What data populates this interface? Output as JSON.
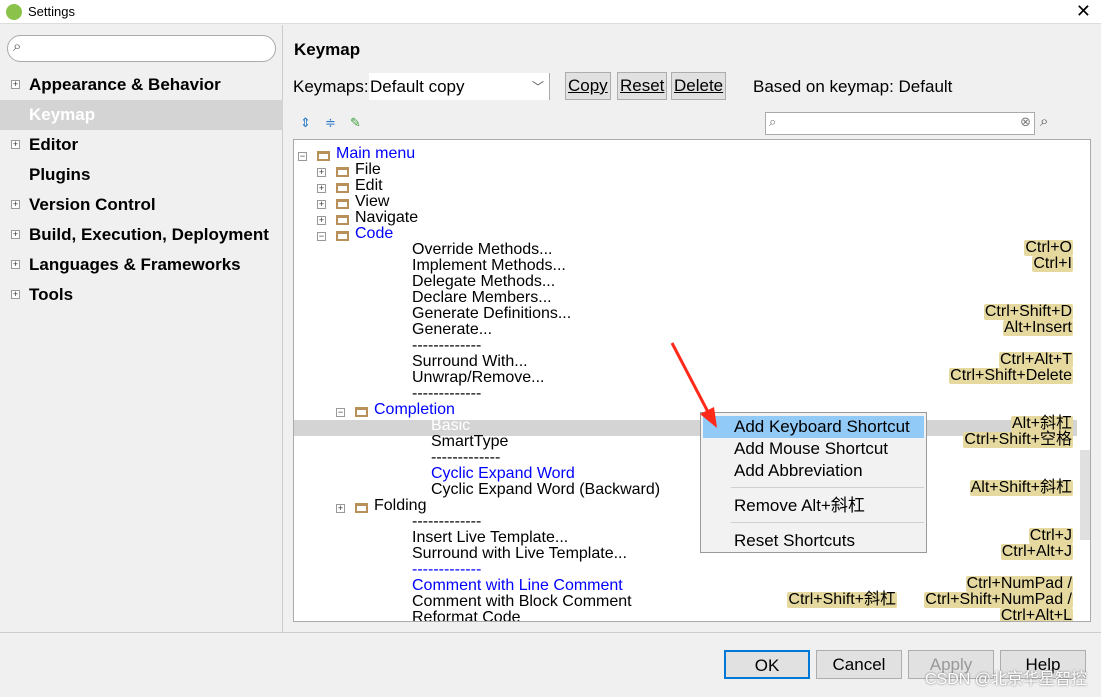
{
  "window": {
    "title": "Settings"
  },
  "sidebar": {
    "search_placeholder": "",
    "items": [
      {
        "label": "Appearance & Behavior",
        "expandable": true
      },
      {
        "label": "Keymap",
        "selected": true
      },
      {
        "label": "Editor",
        "expandable": true
      },
      {
        "label": "Plugins"
      },
      {
        "label": "Version Control",
        "expandable": true
      },
      {
        "label": "Build, Execution, Deployment",
        "expandable": true
      },
      {
        "label": "Languages & Frameworks",
        "expandable": true
      },
      {
        "label": "Tools",
        "expandable": true
      }
    ]
  },
  "main": {
    "title": "Keymap",
    "keymaps_label": "Keymaps:",
    "keymap_value": "Default copy",
    "copy": "Copy",
    "reset": "Reset",
    "delete": "Delete",
    "based_on": "Based on keymap: Default",
    "filter_value": ""
  },
  "tree": [
    {
      "label": "Main menu",
      "level": 0,
      "type": "root",
      "blue": true,
      "expanded": true
    },
    {
      "label": "File",
      "level": 1,
      "type": "folder"
    },
    {
      "label": "Edit",
      "level": 1,
      "type": "folder"
    },
    {
      "label": "View",
      "level": 1,
      "type": "folder"
    },
    {
      "label": "Navigate",
      "level": 1,
      "type": "folder"
    },
    {
      "label": "Code",
      "level": 1,
      "type": "folder",
      "blue": true,
      "expanded": true
    },
    {
      "label": "Override Methods...",
      "level": 2,
      "shortcuts": [
        "Ctrl+O"
      ]
    },
    {
      "label": "Implement Methods...",
      "level": 2,
      "shortcuts": [
        "Ctrl+I"
      ]
    },
    {
      "label": "Delegate Methods...",
      "level": 2
    },
    {
      "label": "Declare Members...",
      "level": 2
    },
    {
      "label": "Generate Definitions...",
      "level": 2,
      "shortcuts": [
        "Ctrl+Shift+D"
      ]
    },
    {
      "label": "Generate...",
      "level": 2,
      "shortcuts": [
        "Alt+Insert"
      ]
    },
    {
      "label": "-------------",
      "level": 2
    },
    {
      "label": "Surround With...",
      "level": 2,
      "shortcuts": [
        "Ctrl+Alt+T"
      ]
    },
    {
      "label": "Unwrap/Remove...",
      "level": 2,
      "shortcuts": [
        "Ctrl+Shift+Delete"
      ]
    },
    {
      "label": "-------------",
      "level": 2
    },
    {
      "label": "Completion",
      "level": 2,
      "type": "folder",
      "blue": true,
      "expanded": true
    },
    {
      "label": "Basic",
      "level": 3,
      "selected": true,
      "shortcuts": [
        "Alt+斜杠"
      ]
    },
    {
      "label": "SmartType",
      "level": 3,
      "shortcuts": [
        "Ctrl+Shift+空格"
      ]
    },
    {
      "label": "-------------",
      "level": 3
    },
    {
      "label": "Cyclic Expand Word",
      "level": 3,
      "blue": true
    },
    {
      "label": "Cyclic Expand Word (Backward)",
      "level": 3,
      "shortcuts": [
        "Alt+Shift+斜杠"
      ]
    },
    {
      "label": "Folding",
      "level": 2,
      "type": "folder"
    },
    {
      "label": "-------------",
      "level": 2
    },
    {
      "label": "Insert Live Template...",
      "level": 2,
      "shortcuts": [
        "Ctrl+J"
      ]
    },
    {
      "label": "Surround with Live Template...",
      "level": 2,
      "shortcuts": [
        "Ctrl+Alt+J"
      ]
    },
    {
      "label": "-------------",
      "level": 2,
      "blue": true
    },
    {
      "label": "Comment with Line Comment",
      "level": 2,
      "blue": true,
      "shortcuts": [
        "Ctrl+NumPad /"
      ]
    },
    {
      "label": "Comment with Block Comment",
      "level": 2,
      "shortcuts": [
        "Ctrl+Shift+NumPad /",
        "Ctrl+Shift+斜杠"
      ]
    },
    {
      "label": "Reformat Code",
      "level": 2,
      "shortcuts": [
        "Ctrl+Alt+L"
      ]
    }
  ],
  "context_menu": {
    "items": [
      "Add Keyboard Shortcut",
      "Add Mouse Shortcut",
      "Add Abbreviation",
      "Remove Alt+斜杠",
      "Reset Shortcuts"
    ],
    "highlighted": 0
  },
  "footer": {
    "ok": "OK",
    "cancel": "Cancel",
    "apply": "Apply",
    "help": "Help"
  },
  "watermark": "CSDN @北京华星智控",
  "colors": {
    "link": "#0000ff",
    "shortcut_bg": "#e6d9a0",
    "menu_highlight": "#91c9f7",
    "arrow": "#ff2a1a"
  }
}
